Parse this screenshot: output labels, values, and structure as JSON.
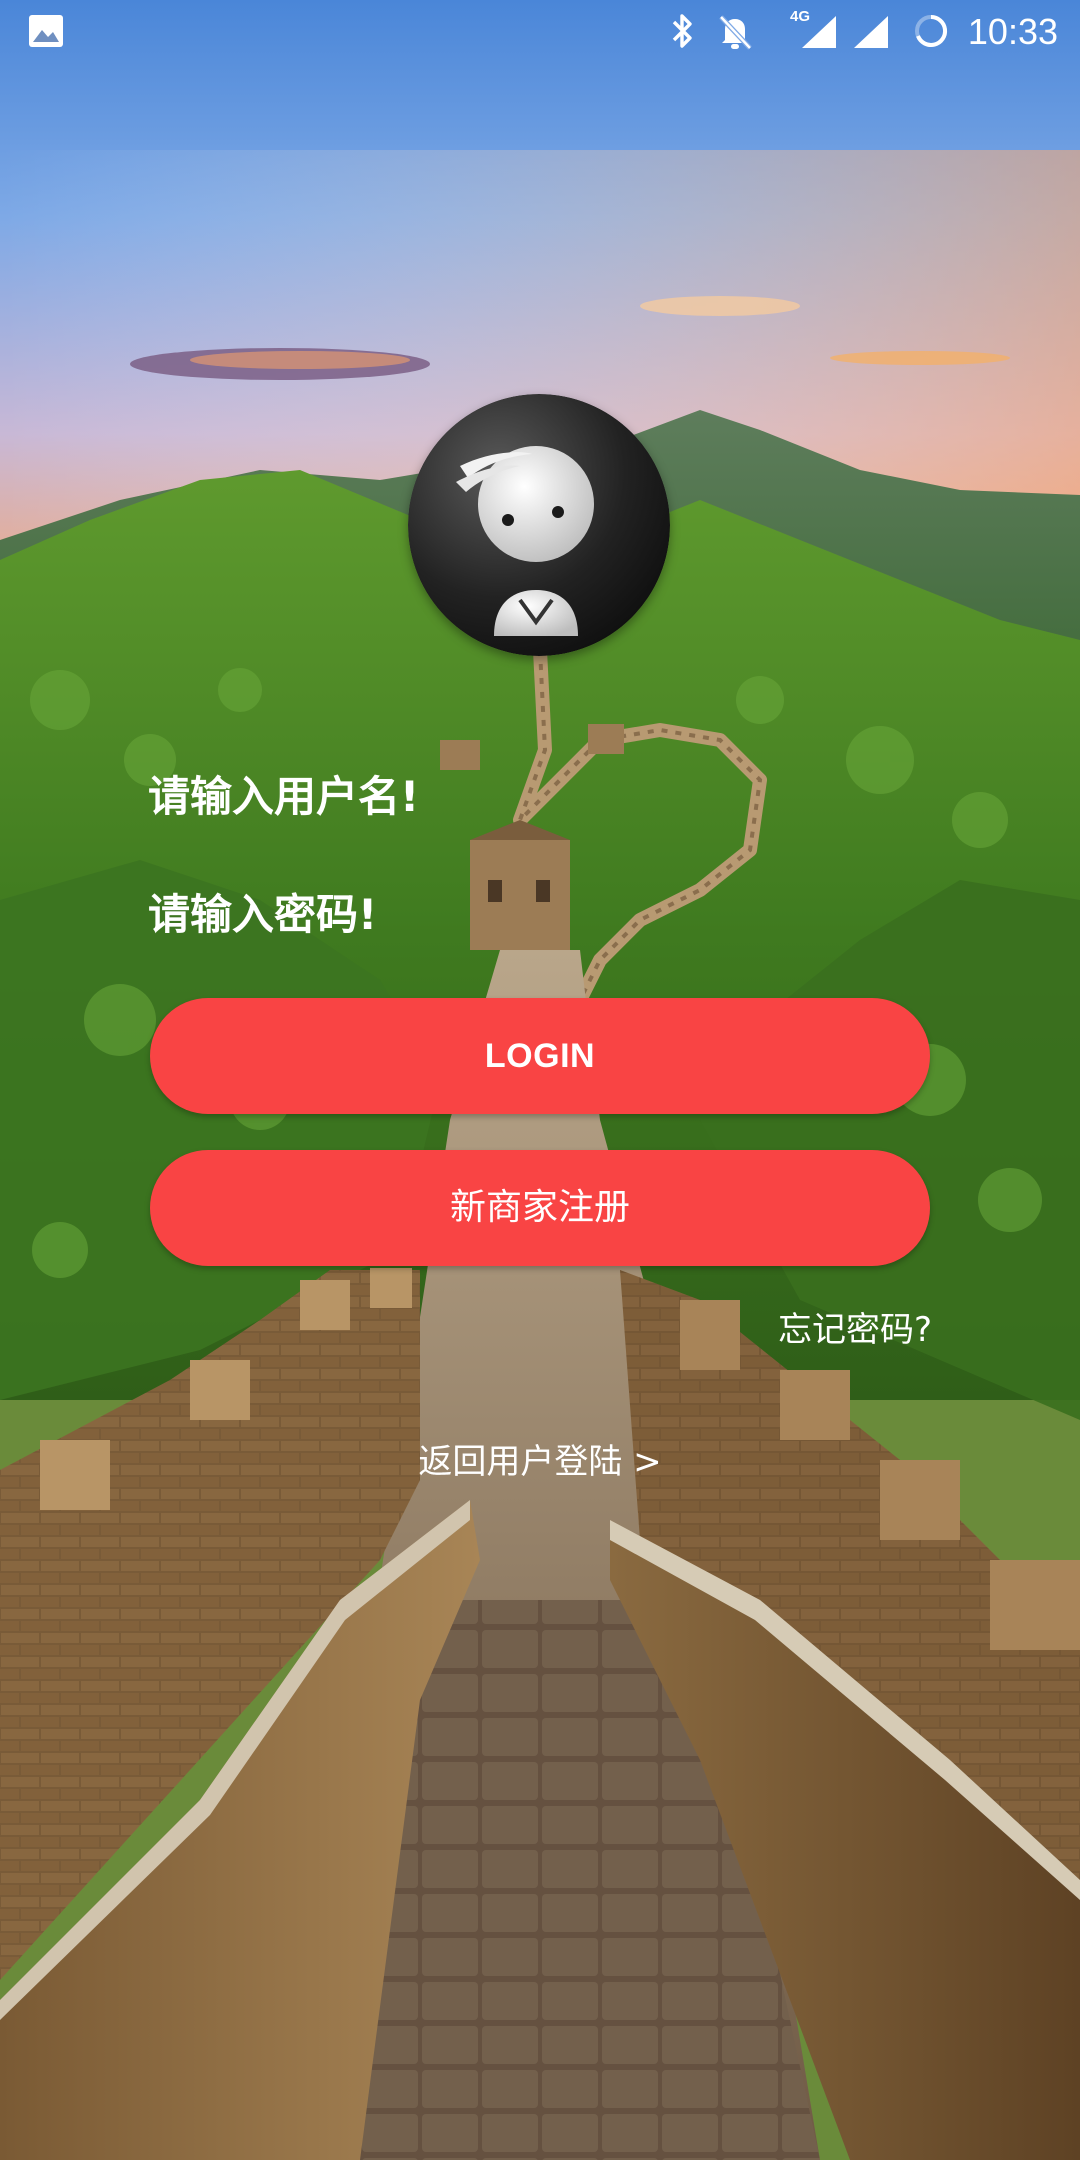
{
  "status_bar": {
    "time": "10:33",
    "network": "4G",
    "icons": [
      "image-notification-icon",
      "bluetooth-icon",
      "notifications-off-icon",
      "signal-icon",
      "signal-icon",
      "loading-icon"
    ]
  },
  "login": {
    "username_placeholder": "请输入用户名!",
    "password_placeholder": "请输入密码!",
    "login_label": "LOGIN",
    "register_label": "新商家注册",
    "forgot_label": "忘记密码?",
    "back_label": "返回用户登陆 >"
  },
  "colors": {
    "button_red": "#f94444",
    "text_white": "#ffffff"
  }
}
